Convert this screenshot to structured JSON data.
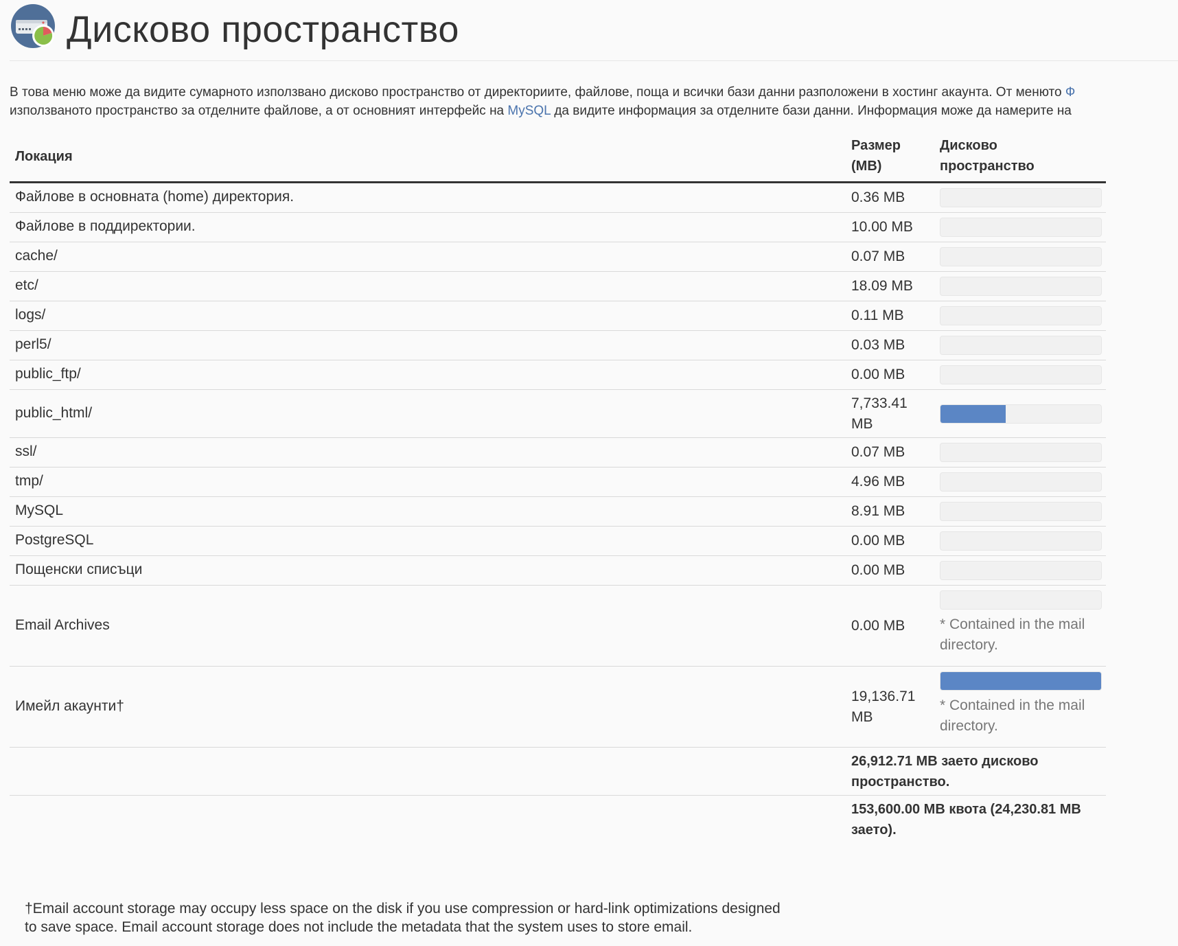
{
  "page": {
    "title": "Дисково пространство",
    "intro": {
      "line1_text": "В това меню може да видите сумарното използвано дисково пространство от директориите, файлове, поща и всички бази данни разположени в хостинг акаунта. От менюто ",
      "line1_link": "Ф",
      "line2_text_a": "използваното пространство за отделните файлове, а от основният интерфейс на ",
      "line2_link": "MySQL",
      "line2_text_b": " да видите информация за отделните бази данни. Информация може да намерите на"
    }
  },
  "table": {
    "headers": {
      "location": "Локация",
      "size_line1": "Размер",
      "size_line2": "(MB)",
      "disk_line1": "Дисково",
      "disk_line2": "пространство"
    },
    "rows": [
      {
        "location": "Файлове в основната (home) директория.",
        "link": false,
        "size": "0.36 MB",
        "fraction": 0
      },
      {
        "location": "Файлове в поддиректории.",
        "link": false,
        "size": "10.00 MB",
        "fraction": 0
      },
      {
        "location": "cache/",
        "link": true,
        "size": "0.07 MB",
        "fraction": 0
      },
      {
        "location": "etc/",
        "link": true,
        "size": "18.09 MB",
        "fraction": 0
      },
      {
        "location": "logs/",
        "link": true,
        "size": "0.11 MB",
        "fraction": 0
      },
      {
        "location": "perl5/",
        "link": true,
        "size": "0.03 MB",
        "fraction": 0
      },
      {
        "location": "public_ftp/",
        "link": true,
        "size": "0.00 MB",
        "fraction": 0
      },
      {
        "location": "public_html/",
        "link": true,
        "size_line1": "7,733.41",
        "size_line2": "MB",
        "fraction": 0.404
      },
      {
        "location": "ssl/",
        "link": true,
        "size": "0.07 MB",
        "fraction": 0
      },
      {
        "location": "tmp/",
        "link": true,
        "size": "4.96 MB",
        "fraction": 0
      },
      {
        "location": "MySQL",
        "link": true,
        "size": "8.91 MB",
        "fraction": 0
      },
      {
        "location": "PostgreSQL",
        "link": true,
        "size": "0.00 MB",
        "fraction": 0
      },
      {
        "location": "Пощенски списъци",
        "link": true,
        "size": "0.00 MB",
        "fraction": 0
      },
      {
        "location": "Email Archives",
        "link": false,
        "size": "0.00 MB",
        "fraction": 0,
        "note_line1": "* Contained in the mail",
        "note_line2": "directory."
      },
      {
        "location": "Имейл акаунти†",
        "link": true,
        "size_line1": "19,136.71",
        "size_line2": "MB",
        "fraction": 1.0,
        "note_line1": "* Contained in the mail",
        "note_line2": "directory."
      }
    ],
    "total_used_line1": "26,912.71 MB заето дисково",
    "total_used_line2": "пространство.",
    "quota_line1": "153,600.00 MB квота (24,230.81 MB",
    "quota_line2": "заето)."
  },
  "footnote": {
    "line1": "†Email account storage may occupy less space on the disk if you use compression or hard-link optimizations designed",
    "line2": "to save space. Email account storage does not include the metadata that the system uses to store email."
  },
  "colors": {
    "link": "#4b74ad",
    "bar_fill": "#5b86c5",
    "bar_track": "#f1f1f1"
  },
  "icons": {
    "page_icon": "disk-usage-icon"
  }
}
